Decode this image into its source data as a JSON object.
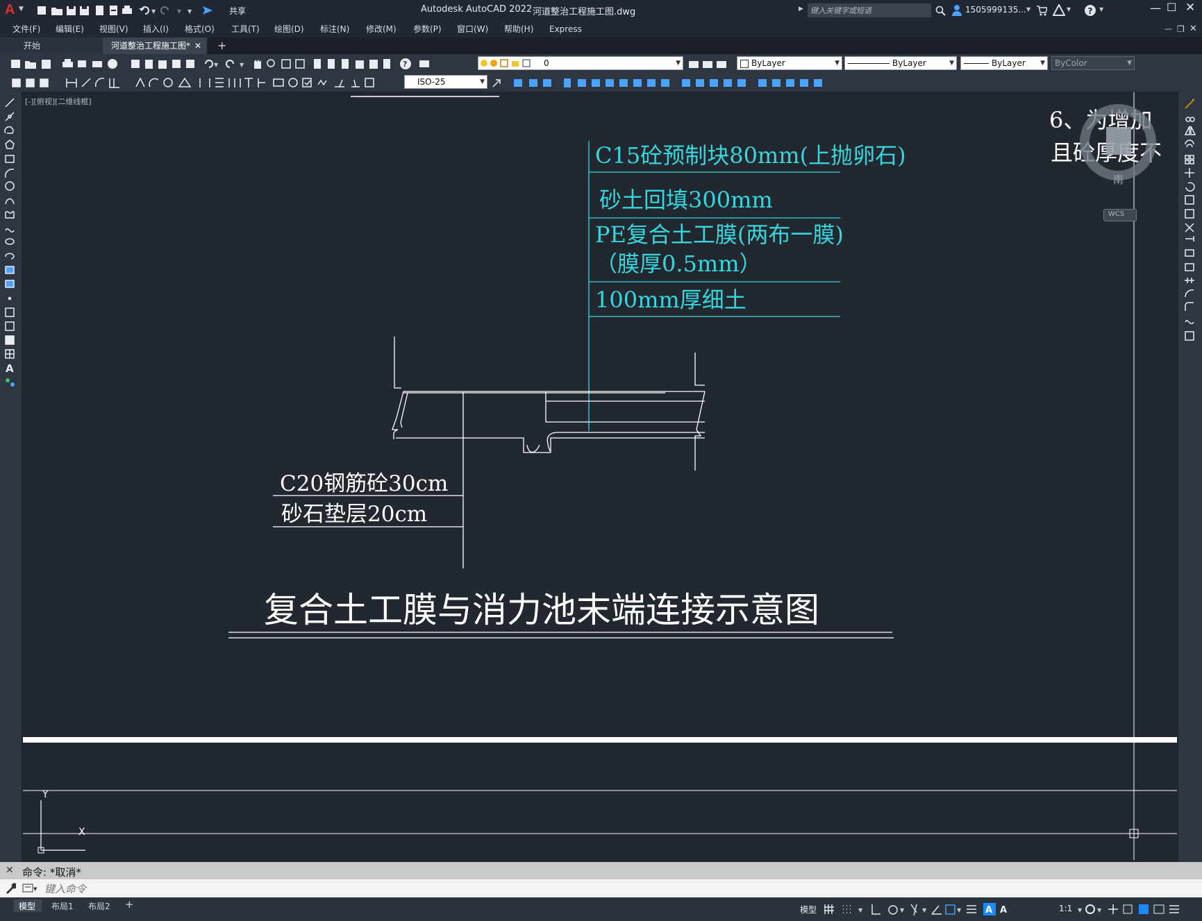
{
  "app": {
    "logo": "A",
    "title": "Autodesk AutoCAD 2022",
    "filename": "河道整治工程施工图.dwg",
    "search_placeholder": "键入关键字或短语",
    "user": "1505999135...",
    "share_label": "共享"
  },
  "menu": [
    "文件(F)",
    "编辑(E)",
    "视图(V)",
    "插入(I)",
    "格式(O)",
    "工具(T)",
    "绘图(D)",
    "标注(N)",
    "修改(M)",
    "参数(P)",
    "窗口(W)",
    "帮助(H)",
    "Express"
  ],
  "tabs": {
    "start": "开始",
    "active": "河道整治工程施工图*"
  },
  "layer": {
    "current": "0",
    "color": "ByLayer",
    "linetype": "ByLayer",
    "lineweight": "ByLayer",
    "plotstyle": "ByColor",
    "dimstyle": "ISO-25"
  },
  "viewport_label": "[-][俯视][二维线框]",
  "viewcube": {
    "south": "南",
    "wcs": "WCS"
  },
  "drawing": {
    "labels_cyan": [
      "C15砼预制块80mm(上抛卵石)",
      "砂土回填300mm",
      "PE复合土工膜(两布一膜)",
      "（膜厚0.5mm）",
      "100mm厚细土"
    ],
    "labels_white": [
      "C20钢筋砼30cm",
      "砂石垫层20cm"
    ],
    "title": "复合土工膜与消力池末端连接示意图",
    "notes_partial": [
      "6、为增加",
      "且砼厚度不"
    ]
  },
  "ucs": {
    "x": "X",
    "y": "Y"
  },
  "command": {
    "history": "命令: *取消*",
    "placeholder": "键入命令"
  },
  "layout_tabs": [
    "模型",
    "布局1",
    "布局2"
  ],
  "status": {
    "model_label": "模型",
    "scale": "1:1"
  },
  "colors": {
    "background": "#212830",
    "cyan": "#38d5dc",
    "white": "#ffffff",
    "accent": "#1a8cff"
  }
}
